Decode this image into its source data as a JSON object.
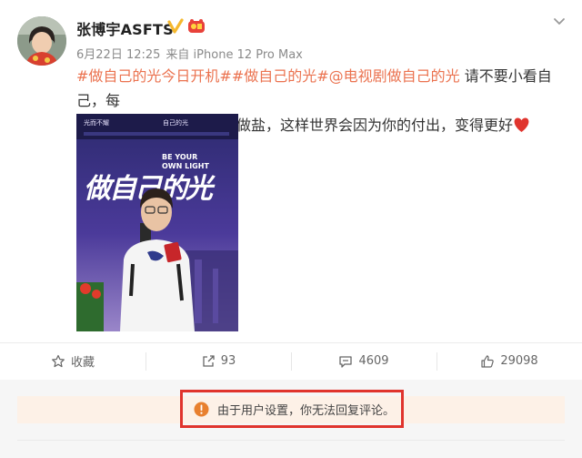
{
  "user": {
    "name": "张博宇ASFTS",
    "avatar_icon": "avatar-photo",
    "verified_icon": "verified-v-icon",
    "badge_icon": "fan-badge-icon"
  },
  "post_meta": {
    "date": "6月22日 12:25",
    "source": "来自 iPhone 12 Pro Max"
  },
  "post": {
    "tag1": "#做自己的光今日开机#",
    "tag2": "#做自己的光#",
    "tag3": "@电视剧做自己的光",
    "text_line1": " 请不要小看自己，每",
    "text_line2": "个人都能发光发热，做光做盐，这样世界会因为你的付出，变得更好"
  },
  "poster": {
    "slogan_left": "光而不耀",
    "slogan_right": "自己的光",
    "en_line1": "BE YOUR",
    "en_line2": "OWN LIGHT",
    "title": "做自己的光"
  },
  "actions": {
    "favorite": "收藏",
    "repost_count": "93",
    "comment_count": "4609",
    "like_count": "29098"
  },
  "notice": {
    "text": "由于用户设置，你无法回复评论。"
  },
  "colors": {
    "tag": "#eb7350",
    "alert_border": "#e0342d",
    "alert_icon": "#e8802f",
    "notice_bg": "#fdf1e7"
  }
}
